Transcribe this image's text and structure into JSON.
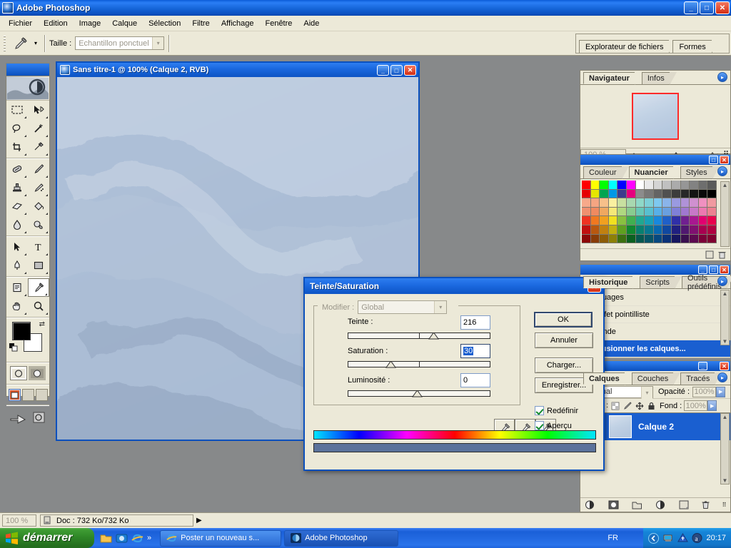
{
  "app": {
    "title": "Adobe Photoshop",
    "window_buttons": {
      "minimize": "_",
      "maximize": "□",
      "close": "✕"
    }
  },
  "menubar": {
    "items": [
      "Fichier",
      "Edition",
      "Image",
      "Calque",
      "Sélection",
      "Filtre",
      "Affichage",
      "Fenêtre",
      "Aide"
    ]
  },
  "options_bar": {
    "tool_icon": "eyedropper-icon",
    "size_label": "Taille :",
    "size_value": "Echantillon ponctuel",
    "palette_well_tabs": [
      "Explorateur de fichiers",
      "Formes"
    ]
  },
  "toolbox": {
    "tools": [
      {
        "name": "marquee-tool",
        "glyph": "rect-marquee"
      },
      {
        "name": "move-tool",
        "glyph": "move"
      },
      {
        "name": "lasso-tool",
        "glyph": "lasso"
      },
      {
        "name": "magic-wand-tool",
        "glyph": "wand"
      },
      {
        "name": "crop-tool",
        "glyph": "crop"
      },
      {
        "name": "slice-tool",
        "glyph": "slice"
      },
      {
        "name": "healing-brush-tool",
        "glyph": "healing"
      },
      {
        "name": "brush-tool",
        "glyph": "brush"
      },
      {
        "name": "clone-stamp-tool",
        "glyph": "stamp"
      },
      {
        "name": "history-brush-tool",
        "glyph": "historybrush"
      },
      {
        "name": "eraser-tool",
        "glyph": "eraser"
      },
      {
        "name": "gradient-tool",
        "glyph": "paintbucket"
      },
      {
        "name": "blur-tool",
        "glyph": "blur"
      },
      {
        "name": "dodge-tool",
        "glyph": "dodge"
      },
      {
        "name": "path-selection-tool",
        "glyph": "arrow"
      },
      {
        "name": "type-tool",
        "glyph": "type"
      },
      {
        "name": "pen-tool",
        "glyph": "pen"
      },
      {
        "name": "shape-tool",
        "glyph": "shape"
      },
      {
        "name": "notes-tool",
        "glyph": "notes"
      },
      {
        "name": "eyedropper-tool",
        "glyph": "eyedropper"
      },
      {
        "name": "hand-tool",
        "glyph": "hand"
      },
      {
        "name": "zoom-tool",
        "glyph": "zoom"
      }
    ],
    "selected_tool": "eyedropper-tool",
    "foreground_color": "#000000",
    "background_color": "#ffffff"
  },
  "document_window": {
    "title": "Sans titre-1 @ 100% (Calque 2, RVB)",
    "buttons": {
      "minimize": "_",
      "maximize": "□",
      "close": "✕"
    }
  },
  "navigator_panel": {
    "tabs": [
      {
        "label": "Navigateur",
        "active": true
      },
      {
        "label": "Infos",
        "active": false
      }
    ],
    "zoom_value": "100 %"
  },
  "swatches_panel": {
    "tabs": [
      {
        "label": "Couleur",
        "active": false
      },
      {
        "label": "Nuancier",
        "active": true
      },
      {
        "label": "Styles",
        "active": false
      }
    ],
    "colors": [
      [
        "#ff0000",
        "#ffff00",
        "#00ff00",
        "#00ffff",
        "#0000ff",
        "#ff00ff",
        "#ffffff",
        "#e8e8e8",
        "#d4d4d4",
        "#c0c0c0",
        "#ababab",
        "#969696",
        "#828282",
        "#6e6e6e",
        "#5a5a5a"
      ],
      [
        "#e60000",
        "#e6e600",
        "#00a550",
        "#0099e6",
        "#3c3c8c",
        "#e6007e",
        "#8c8c8c",
        "#787878",
        "#646464",
        "#505050",
        "#3c3c3c",
        "#282828",
        "#141414",
        "#0a0a0a",
        "#000000"
      ],
      [
        "#f7a98a",
        "#f5a582",
        "#f7c08a",
        "#faf0a0",
        "#c8e0a0",
        "#a8d8b0",
        "#8ed8c8",
        "#7ed0d8",
        "#7ec8f0",
        "#8ab4ea",
        "#9a9ae0",
        "#b092d8",
        "#d090d0",
        "#f090c0",
        "#f09aa0"
      ],
      [
        "#f09070",
        "#f08a60",
        "#f0a860",
        "#f5e878",
        "#b0d880",
        "#88cc90",
        "#68c8b8",
        "#58c0d0",
        "#58b0e8",
        "#6aa0e0",
        "#8080d8",
        "#a078d0",
        "#c878c8",
        "#ec78b0",
        "#ec8090"
      ],
      [
        "#ee3322",
        "#f07820",
        "#f0a020",
        "#f0e020",
        "#88c040",
        "#40b050",
        "#20a890",
        "#18a0b8",
        "#1888dd",
        "#2060c8",
        "#3030a8",
        "#702090",
        "#a81890",
        "#e00070",
        "#e8004c"
      ],
      [
        "#c01010",
        "#b85810",
        "#c08010",
        "#c0b010",
        "#5ea020",
        "#108830",
        "#088070",
        "#087890",
        "#0868b0",
        "#1048a0",
        "#202080",
        "#501870",
        "#801070",
        "#a80050",
        "#b00040"
      ],
      [
        "#8c0808",
        "#883c08",
        "#8c5c08",
        "#8c8008",
        "#3c7010",
        "#0a6020",
        "#065850",
        "#065468",
        "#064880",
        "#0a3278",
        "#161660",
        "#3a1050",
        "#5c0a50",
        "#7c0038",
        "#800030"
      ]
    ]
  },
  "history_panel": {
    "tabs": [
      {
        "label": "Historique",
        "active": true
      },
      {
        "label": "Scripts",
        "active": false
      },
      {
        "label": "Outils prédéfinis",
        "active": false
      }
    ],
    "items": [
      {
        "label": "Nuages",
        "selected": false
      },
      {
        "label": "Effet pointilliste",
        "selected": false
      },
      {
        "label": "Onde",
        "selected": false
      },
      {
        "label": "Fusionner les calques...",
        "selected": true
      }
    ]
  },
  "layers_panel": {
    "tabs": [
      {
        "label": "Calques",
        "active": true
      },
      {
        "label": "Couches",
        "active": false
      },
      {
        "label": "Tracés",
        "active": false
      }
    ],
    "blend_mode": "Normal",
    "opacity_label": "Opacité :",
    "opacity_value": "100%",
    "fill_label": "Fond :",
    "fill_value": "100%",
    "layers": [
      {
        "name": "Calque 2",
        "selected": true
      }
    ]
  },
  "dialog": {
    "title": "Teinte/Saturation",
    "close_label": "✕",
    "modifier_label": "Modifier :",
    "modifier_value": "Global",
    "sliders": [
      {
        "label": "Teinte :",
        "value": "216",
        "knob_pct": 60,
        "focused": false
      },
      {
        "label": "Saturation :",
        "value": "30",
        "knob_pct": 30,
        "focused": true
      },
      {
        "label": "Luminosité :",
        "value": "0",
        "knob_pct": 50,
        "focused": false
      }
    ],
    "buttons": [
      {
        "label": "OK",
        "default": true
      },
      {
        "label": "Annuler",
        "default": false
      },
      {
        "label": "Charger...",
        "default": false
      },
      {
        "label": "Enregistrer...",
        "default": false
      }
    ],
    "eyedroppers": [
      "eyedropper-icon",
      "eyedropper-plus-icon",
      "eyedropper-minus-icon"
    ],
    "checkboxes": [
      {
        "label": "Redéfinir",
        "checked": true
      },
      {
        "label": "Aperçu",
        "checked": true
      }
    ],
    "result_color": "#5b729b"
  },
  "status_bar": {
    "zoom": "100 %",
    "doc_info": "Doc : 732 Ko/732 Ko",
    "arrow": "▶"
  },
  "taskbar": {
    "start_label": "démarrer",
    "quick_launch": [
      "folder-icon",
      "media-icon",
      "internet-explorer-icon"
    ],
    "overflow": "»",
    "tasks": [
      {
        "label": "Poster un nouveau s...",
        "icon": "internet-explorer-icon",
        "active": false
      },
      {
        "label": "Adobe Photoshop",
        "icon": "photoshop-icon",
        "active": true
      }
    ],
    "language": "FR",
    "tray_icons": [
      "network-icon",
      "safely-remove-icon",
      "antivirus-icon"
    ],
    "clock": "20:17"
  }
}
